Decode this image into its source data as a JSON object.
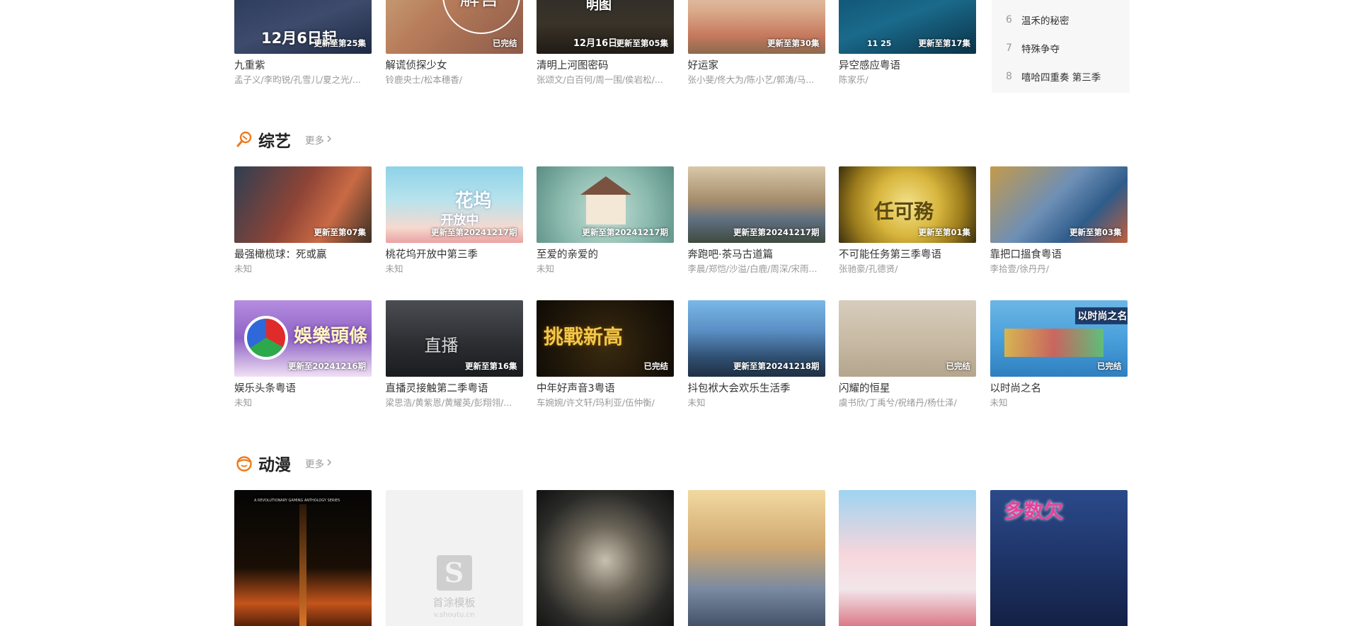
{
  "top_row": [
    {
      "title": "九重紫",
      "sub": "孟子义/李昀锐/孔雪儿/夏之光/...",
      "badge": "更新至第25集",
      "overlay": "12月6日起"
    },
    {
      "title": "解谎侦探少女",
      "sub": "铃鹿央士/松本穗香/",
      "badge": "已完结",
      "overlay": "解言"
    },
    {
      "title": "清明上河图密码",
      "sub": "张颂文/白百何/周一围/侯岩松/...",
      "badge": "更新至第05集",
      "overlay": "12月16日",
      "overlay2": "码河明图"
    },
    {
      "title": "好运家",
      "sub": "张小斐/佟大为/陈小艺/郭涛/马...",
      "badge": "更新至第30集"
    },
    {
      "title": "异空感应粤语",
      "sub": "陈家乐/",
      "badge": "更新至第17集",
      "overlay": "11 25"
    }
  ],
  "ranking": [
    {
      "num": "6",
      "name": "温禾的秘密"
    },
    {
      "num": "7",
      "name": "特殊争夺"
    },
    {
      "num": "8",
      "name": "嘻哈四重奏 第三季"
    }
  ],
  "variety": {
    "label": "综艺",
    "more": "更多",
    "row1": [
      {
        "title": "最强橄榄球：死或赢",
        "sub": "未知",
        "badge": "更新至第07集"
      },
      {
        "title": "桃花坞开放中第三季",
        "sub": "未知",
        "badge": "更新至第20241217期",
        "overlay": "花坞",
        "overlay2": "开放中"
      },
      {
        "title": "至爱的亲爱的",
        "sub": "未知",
        "badge": "更新至第20241217期"
      },
      {
        "title": "奔跑吧·茶马古道篇",
        "sub": "李晨/郑恺/沙溢/白鹿/周深/宋雨...",
        "badge": "更新至第20241217期"
      },
      {
        "title": "不可能任务第三季粤语",
        "sub": "张驰豪/孔德贤/",
        "badge": "更新至第01集",
        "overlay": "任可務"
      },
      {
        "title": "靠把口搵食粤语",
        "sub": "李拾壹/徐丹丹/",
        "badge": "更新至第03集"
      }
    ],
    "row2": [
      {
        "title": "娱乐头条粤语",
        "sub": "未知",
        "badge": "更新至20241216期",
        "overlay": "娛樂頭條"
      },
      {
        "title": "直播灵接触第二季粤语",
        "sub": "梁思浩/黄紫恩/黄耀英/彭翔翎/...",
        "badge": "更新至第16集",
        "overlay": "直播"
      },
      {
        "title": "中年好声音3粤语",
        "sub": "车婉婉/许文轩/玛利亚/伍仲衡/",
        "badge": "已完结",
        "overlay": "挑戰新高"
      },
      {
        "title": "抖包袱大会欢乐生活季",
        "sub": "未知",
        "badge": "更新至第20241218期"
      },
      {
        "title": "闪耀的恒星",
        "sub": "虞书欣/丁禹兮/祝绪丹/杨仕泽/",
        "badge": "已完结"
      },
      {
        "title": "以时尚之名",
        "sub": "未知",
        "badge": "已完结",
        "overlay": "以时尚之名"
      }
    ]
  },
  "anime": {
    "label": "动漫",
    "more": "更多",
    "items": [
      {
        "top_text": "A REVOLUTIONARY GAMING ANTHOLOGY SERIES"
      },
      {
        "logo_t1": "首涂模板",
        "logo_t2": "v.shoutu.cn",
        "logo_mark": "S"
      },
      {},
      {},
      {},
      {
        "overlay": "多数欠"
      }
    ]
  },
  "colors": {
    "accent": "#f07a1a",
    "text": "#333333",
    "muted": "#999999",
    "panel": "#f7f7f7"
  }
}
